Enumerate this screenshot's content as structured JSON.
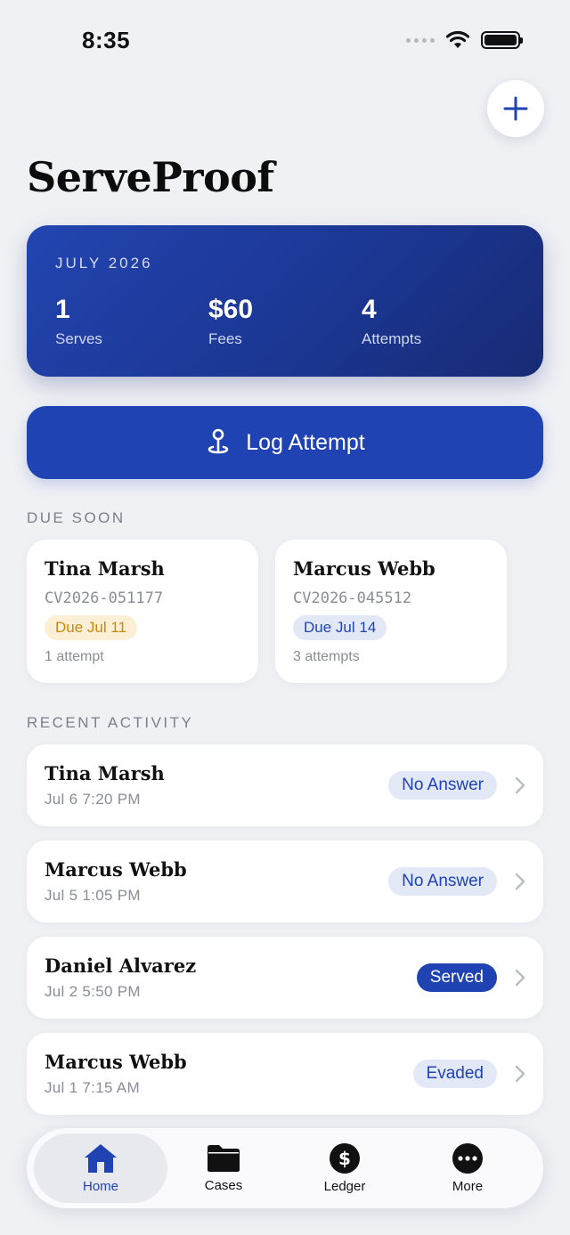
{
  "status_bar": {
    "time": "8:35"
  },
  "header": {
    "title": "ServeProof",
    "add_icon": "plus-icon"
  },
  "summary": {
    "month": "JULY 2026",
    "stats": [
      {
        "value": "1",
        "label": "Serves"
      },
      {
        "value": "$60",
        "label": "Fees"
      },
      {
        "value": "4",
        "label": "Attempts"
      }
    ]
  },
  "log_attempt": {
    "label": "Log Attempt",
    "icon": "map-pin-icon"
  },
  "due_soon": {
    "label": "DUE SOON",
    "cards": [
      {
        "name": "Tina Marsh",
        "case": "CV2026-051177",
        "due": "Due Jul 11",
        "attempts": "1 attempt",
        "tone": "amber"
      },
      {
        "name": "Marcus Webb",
        "case": "CV2026-045512",
        "due": "Due Jul 14",
        "attempts": "3 attempts",
        "tone": "blue"
      }
    ]
  },
  "recent_activity": {
    "label": "RECENT ACTIVITY",
    "items": [
      {
        "name": "Tina Marsh",
        "time": "Jul 6  7:20 PM",
        "status": "No Answer"
      },
      {
        "name": "Marcus Webb",
        "time": "Jul 5  1:05 PM",
        "status": "No Answer"
      },
      {
        "name": "Daniel Alvarez",
        "time": "Jul 2  5:50 PM",
        "status": "Served"
      },
      {
        "name": "Marcus Webb",
        "time": "Jul 1  7:15 AM",
        "status": "Evaded"
      }
    ]
  },
  "tabbar": {
    "tabs": [
      {
        "label": "Home",
        "icon": "home-icon",
        "active": true
      },
      {
        "label": "Cases",
        "icon": "folder-icon"
      },
      {
        "label": "Ledger",
        "icon": "dollar-icon"
      },
      {
        "label": "More",
        "icon": "more-icon"
      }
    ]
  },
  "colors": {
    "accent": "#1f43b2",
    "background": "#f0f1f5",
    "amber": "#c78a12"
  }
}
